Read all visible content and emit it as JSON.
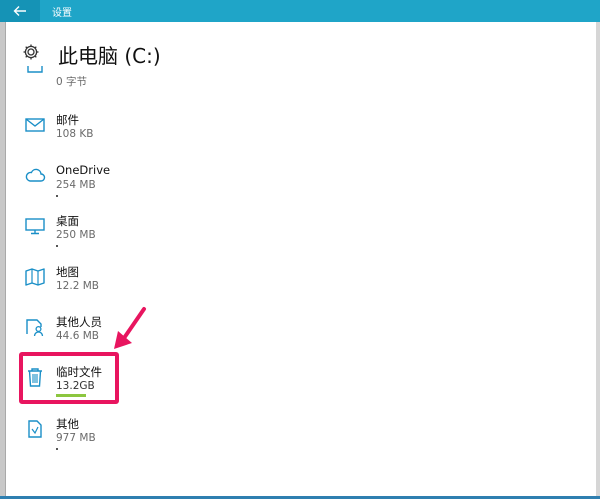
{
  "window": {
    "title": "设置"
  },
  "header": {
    "title": "此电脑 (C:)"
  },
  "items": [
    {
      "icon": "partial-item-icon",
      "size": "0 字节"
    },
    {
      "icon": "mail-icon",
      "name": "邮件",
      "size": "108 KB"
    },
    {
      "icon": "cloud-icon",
      "name": "OneDrive",
      "size": "254 MB"
    },
    {
      "icon": "desktop-monitor-icon",
      "name": "桌面",
      "size": "250 MB"
    },
    {
      "icon": "map-icon",
      "name": "地图",
      "size": "12.2 MB"
    },
    {
      "icon": "other-people-icon",
      "name": "其他人员",
      "size": "44.6 MB"
    },
    {
      "icon": "trash-icon",
      "name": "临时文件",
      "size": "13.2GB"
    },
    {
      "icon": "other-files-icon",
      "name": "其他",
      "size": "977 MB"
    }
  ],
  "colors": {
    "titlebar": "#1fa5c8",
    "accent": "#1a8fc7",
    "highlight": "#e8155f",
    "usage_bar_temp": "#8cc63f"
  }
}
